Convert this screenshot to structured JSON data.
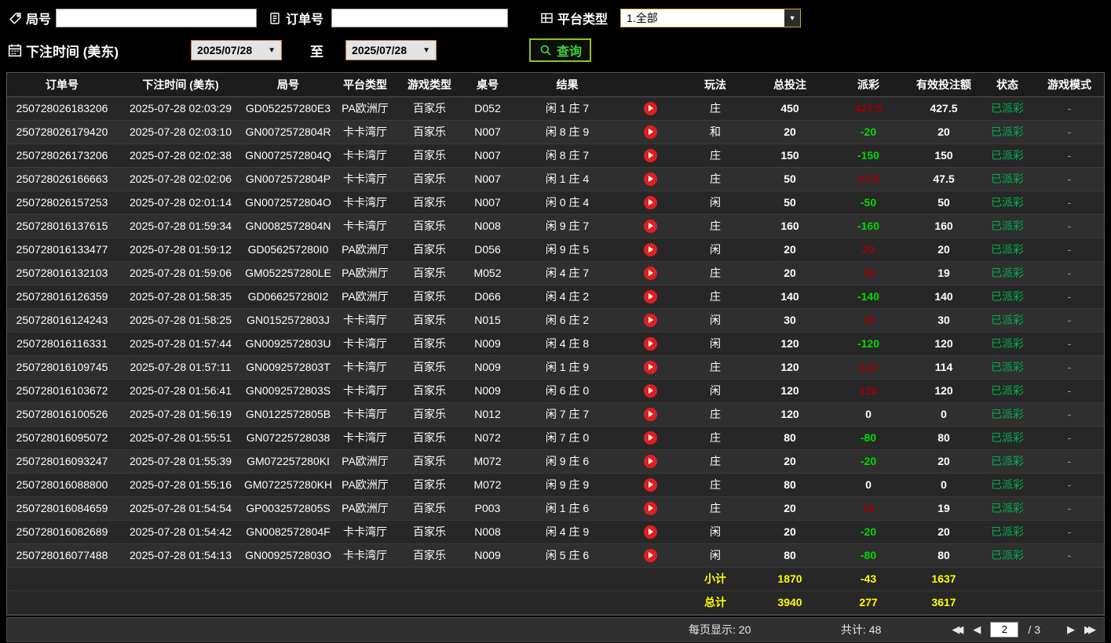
{
  "filters": {
    "game_no_label": "局号",
    "order_no_label": "订单号",
    "platform_label": "平台类型",
    "platform_value": "1.全部",
    "bet_time_label": "下注时间 (美东)",
    "range_to_label": "至",
    "date_from": "2025/07/28",
    "date_to": "2025/07/28",
    "query_label": "查询"
  },
  "icons": {
    "dropdown_arrow": "▼",
    "first_page": "◀◀",
    "prev_page": "◀",
    "next_page": "▶",
    "last_page": "▶▶"
  },
  "colors": {
    "payout_positive": "#a00000",
    "payout_negative": "#00d800",
    "status_paid": "#00b050",
    "summary_yellow": "#ffff00",
    "accent_green": "#3ecf3e"
  },
  "table": {
    "headers": [
      "订单号",
      "下注时间 (美东)",
      "局号",
      "平台类型",
      "游戏类型",
      "桌号",
      "结果",
      "",
      "玩法",
      "总投注",
      "派彩",
      "有效投注额",
      "状态",
      "游戏模式"
    ],
    "rows": [
      {
        "order": "250728026183206",
        "time": "2025-07-28 02:03:29",
        "game": "GD052257280E3",
        "platform": "PA欧洲厅",
        "type": "百家乐",
        "table": "D052",
        "result": "闲 1 庄 7",
        "method": "庄",
        "bet": "450",
        "payout": "427.5",
        "valid": "427.5",
        "status": "已派彩",
        "mode": "-"
      },
      {
        "order": "250728026179420",
        "time": "2025-07-28 02:03:10",
        "game": "GN0072572804R",
        "platform": "卡卡湾厅",
        "type": "百家乐",
        "table": "N007",
        "result": "闲 8 庄 9",
        "method": "和",
        "bet": "20",
        "payout": "-20",
        "valid": "20",
        "status": "已派彩",
        "mode": "-"
      },
      {
        "order": "250728026173206",
        "time": "2025-07-28 02:02:38",
        "game": "GN0072572804Q",
        "platform": "卡卡湾厅",
        "type": "百家乐",
        "table": "N007",
        "result": "闲 8 庄 7",
        "method": "庄",
        "bet": "150",
        "payout": "-150",
        "valid": "150",
        "status": "已派彩",
        "mode": "-"
      },
      {
        "order": "250728026166663",
        "time": "2025-07-28 02:02:06",
        "game": "GN0072572804P",
        "platform": "卡卡湾厅",
        "type": "百家乐",
        "table": "N007",
        "result": "闲 1 庄 4",
        "method": "庄",
        "bet": "50",
        "payout": "47.5",
        "valid": "47.5",
        "status": "已派彩",
        "mode": "-"
      },
      {
        "order": "250728026157253",
        "time": "2025-07-28 02:01:14",
        "game": "GN0072572804O",
        "platform": "卡卡湾厅",
        "type": "百家乐",
        "table": "N007",
        "result": "闲 0 庄 4",
        "method": "闲",
        "bet": "50",
        "payout": "-50",
        "valid": "50",
        "status": "已派彩",
        "mode": "-"
      },
      {
        "order": "250728016137615",
        "time": "2025-07-28 01:59:34",
        "game": "GN0082572804N",
        "platform": "卡卡湾厅",
        "type": "百家乐",
        "table": "N008",
        "result": "闲 9 庄 7",
        "method": "庄",
        "bet": "160",
        "payout": "-160",
        "valid": "160",
        "status": "已派彩",
        "mode": "-"
      },
      {
        "order": "250728016133477",
        "time": "2025-07-28 01:59:12",
        "game": "GD056257280I0",
        "platform": "PA欧洲厅",
        "type": "百家乐",
        "table": "D056",
        "result": "闲 9 庄 5",
        "method": "闲",
        "bet": "20",
        "payout": "20",
        "valid": "20",
        "status": "已派彩",
        "mode": "-"
      },
      {
        "order": "250728016132103",
        "time": "2025-07-28 01:59:06",
        "game": "GM052257280LE",
        "platform": "PA欧洲厅",
        "type": "百家乐",
        "table": "M052",
        "result": "闲 4 庄 7",
        "method": "庄",
        "bet": "20",
        "payout": "19",
        "valid": "19",
        "status": "已派彩",
        "mode": "-"
      },
      {
        "order": "250728016126359",
        "time": "2025-07-28 01:58:35",
        "game": "GD066257280I2",
        "platform": "PA欧洲厅",
        "type": "百家乐",
        "table": "D066",
        "result": "闲 4 庄 2",
        "method": "庄",
        "bet": "140",
        "payout": "-140",
        "valid": "140",
        "status": "已派彩",
        "mode": "-"
      },
      {
        "order": "250728016124243",
        "time": "2025-07-28 01:58:25",
        "game": "GN0152572803J",
        "platform": "卡卡湾厅",
        "type": "百家乐",
        "table": "N015",
        "result": "闲 6 庄 2",
        "method": "闲",
        "bet": "30",
        "payout": "30",
        "valid": "30",
        "status": "已派彩",
        "mode": "-"
      },
      {
        "order": "250728016116331",
        "time": "2025-07-28 01:57:44",
        "game": "GN0092572803U",
        "platform": "卡卡湾厅",
        "type": "百家乐",
        "table": "N009",
        "result": "闲 4 庄 8",
        "method": "闲",
        "bet": "120",
        "payout": "-120",
        "valid": "120",
        "status": "已派彩",
        "mode": "-"
      },
      {
        "order": "250728016109745",
        "time": "2025-07-28 01:57:11",
        "game": "GN0092572803T",
        "platform": "卡卡湾厅",
        "type": "百家乐",
        "table": "N009",
        "result": "闲 1 庄 9",
        "method": "庄",
        "bet": "120",
        "payout": "114",
        "valid": "114",
        "status": "已派彩",
        "mode": "-"
      },
      {
        "order": "250728016103672",
        "time": "2025-07-28 01:56:41",
        "game": "GN0092572803S",
        "platform": "卡卡湾厅",
        "type": "百家乐",
        "table": "N009",
        "result": "闲 6 庄 0",
        "method": "闲",
        "bet": "120",
        "payout": "120",
        "valid": "120",
        "status": "已派彩",
        "mode": "-"
      },
      {
        "order": "250728016100526",
        "time": "2025-07-28 01:56:19",
        "game": "GN0122572805B",
        "platform": "卡卡湾厅",
        "type": "百家乐",
        "table": "N012",
        "result": "闲 7 庄 7",
        "method": "庄",
        "bet": "120",
        "payout": "0",
        "valid": "0",
        "status": "已派彩",
        "mode": "-"
      },
      {
        "order": "250728016095072",
        "time": "2025-07-28 01:55:51",
        "game": "GN07225728038",
        "platform": "卡卡湾厅",
        "type": "百家乐",
        "table": "N072",
        "result": "闲 7 庄 0",
        "method": "庄",
        "bet": "80",
        "payout": "-80",
        "valid": "80",
        "status": "已派彩",
        "mode": "-"
      },
      {
        "order": "250728016093247",
        "time": "2025-07-28 01:55:39",
        "game": "GM072257280KI",
        "platform": "PA欧洲厅",
        "type": "百家乐",
        "table": "M072",
        "result": "闲 9 庄 6",
        "method": "庄",
        "bet": "20",
        "payout": "-20",
        "valid": "20",
        "status": "已派彩",
        "mode": "-"
      },
      {
        "order": "250728016088800",
        "time": "2025-07-28 01:55:16",
        "game": "GM072257280KH",
        "platform": "PA欧洲厅",
        "type": "百家乐",
        "table": "M072",
        "result": "闲 9 庄 9",
        "method": "庄",
        "bet": "80",
        "payout": "0",
        "valid": "0",
        "status": "已派彩",
        "mode": "-"
      },
      {
        "order": "250728016084659",
        "time": "2025-07-28 01:54:54",
        "game": "GP0032572805S",
        "platform": "PA欧洲厅",
        "type": "百家乐",
        "table": "P003",
        "result": "闲 1 庄 6",
        "method": "庄",
        "bet": "20",
        "payout": "19",
        "valid": "19",
        "status": "已派彩",
        "mode": "-"
      },
      {
        "order": "250728016082689",
        "time": "2025-07-28 01:54:42",
        "game": "GN0082572804F",
        "platform": "卡卡湾厅",
        "type": "百家乐",
        "table": "N008",
        "result": "闲 4 庄 9",
        "method": "闲",
        "bet": "20",
        "payout": "-20",
        "valid": "20",
        "status": "已派彩",
        "mode": "-"
      },
      {
        "order": "250728016077488",
        "time": "2025-07-28 01:54:13",
        "game": "GN0092572803O",
        "platform": "卡卡湾厅",
        "type": "百家乐",
        "table": "N009",
        "result": "闲 5 庄 6",
        "method": "闲",
        "bet": "80",
        "payout": "-80",
        "valid": "80",
        "status": "已派彩",
        "mode": "-"
      }
    ]
  },
  "summary": {
    "subtotal_label": "小计",
    "subtotal_values": [
      "1870",
      "-43",
      "1637"
    ],
    "total_label": "总计",
    "total_values": [
      "3940",
      "277",
      "3617"
    ]
  },
  "pagination": {
    "per_page_text": "每页显示: 20",
    "total_text": "共计: 48",
    "current_page": "2",
    "page_separator": "/ 3"
  }
}
